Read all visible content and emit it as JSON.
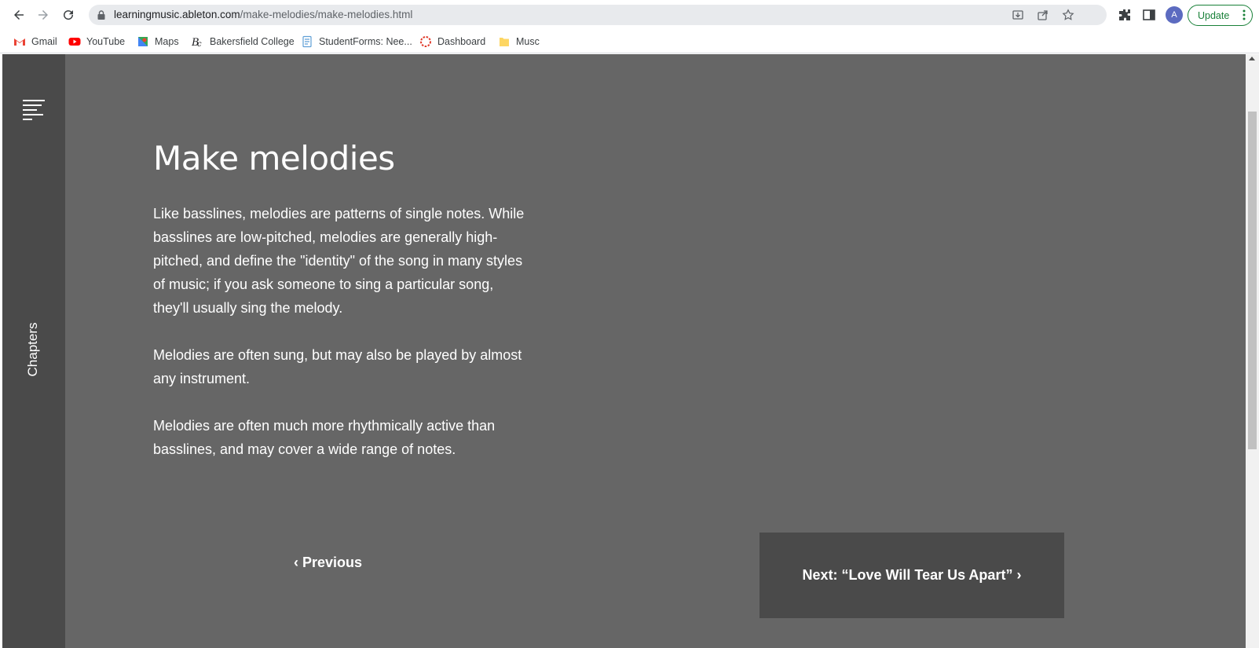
{
  "browser": {
    "url_host": "learningmusic.ableton.com",
    "url_path": "/make-melodies/make-melodies.html",
    "profile_initial": "A",
    "update_label": "Update",
    "icons": {
      "back": "arrow-left-icon",
      "forward": "arrow-right-icon",
      "reload": "reload-icon",
      "lock": "lock-icon",
      "install": "install-app-icon",
      "share": "share-icon",
      "bookmark_star": "star-icon",
      "extensions": "puzzle-icon",
      "side_panel": "side-panel-icon",
      "menu": "kebab-menu-icon"
    },
    "colors": {
      "update_green": "#188038",
      "profile_bg": "#5c6bc0",
      "omnibox_bg": "#e8eaed"
    }
  },
  "bookmarks": [
    {
      "label": "Gmail",
      "icon": "gmail-icon"
    },
    {
      "label": "YouTube",
      "icon": "youtube-icon"
    },
    {
      "label": "Maps",
      "icon": "maps-icon"
    },
    {
      "label": "Bakersfield College",
      "icon": "bc-logo-icon"
    },
    {
      "label": "StudentForms: Nee...",
      "icon": "forms-icon"
    },
    {
      "label": "Dashboard",
      "icon": "dashboard-icon"
    },
    {
      "label": "Musc",
      "icon": "folder-icon"
    }
  ],
  "sidebar": {
    "chapters_label": "Chapters",
    "menu_icon": "hamburger-menu-icon"
  },
  "lesson": {
    "title": "Make melodies",
    "paragraphs": [
      "Like basslines, melodies are patterns of single notes. While basslines are low-pitched, melodies are generally high-pitched, and define the \"identity\" of the song in many styles of music; if you ask someone to sing a particular song, they'll usually sing the melody.",
      "Melodies are often sung, but may also be played by almost any instrument.",
      "Melodies are often much more rhythmically active than basslines, and may cover a wide range of notes."
    ]
  },
  "navigation": {
    "previous_label": "‹ Previous",
    "next_label": "Next: “Love Will Tear Us Apart” ›"
  },
  "theme": {
    "page_bg": "#666666",
    "sidebar_bg": "#4a4a4a",
    "next_button_bg": "#4a4a4a",
    "text": "#ffffff"
  }
}
